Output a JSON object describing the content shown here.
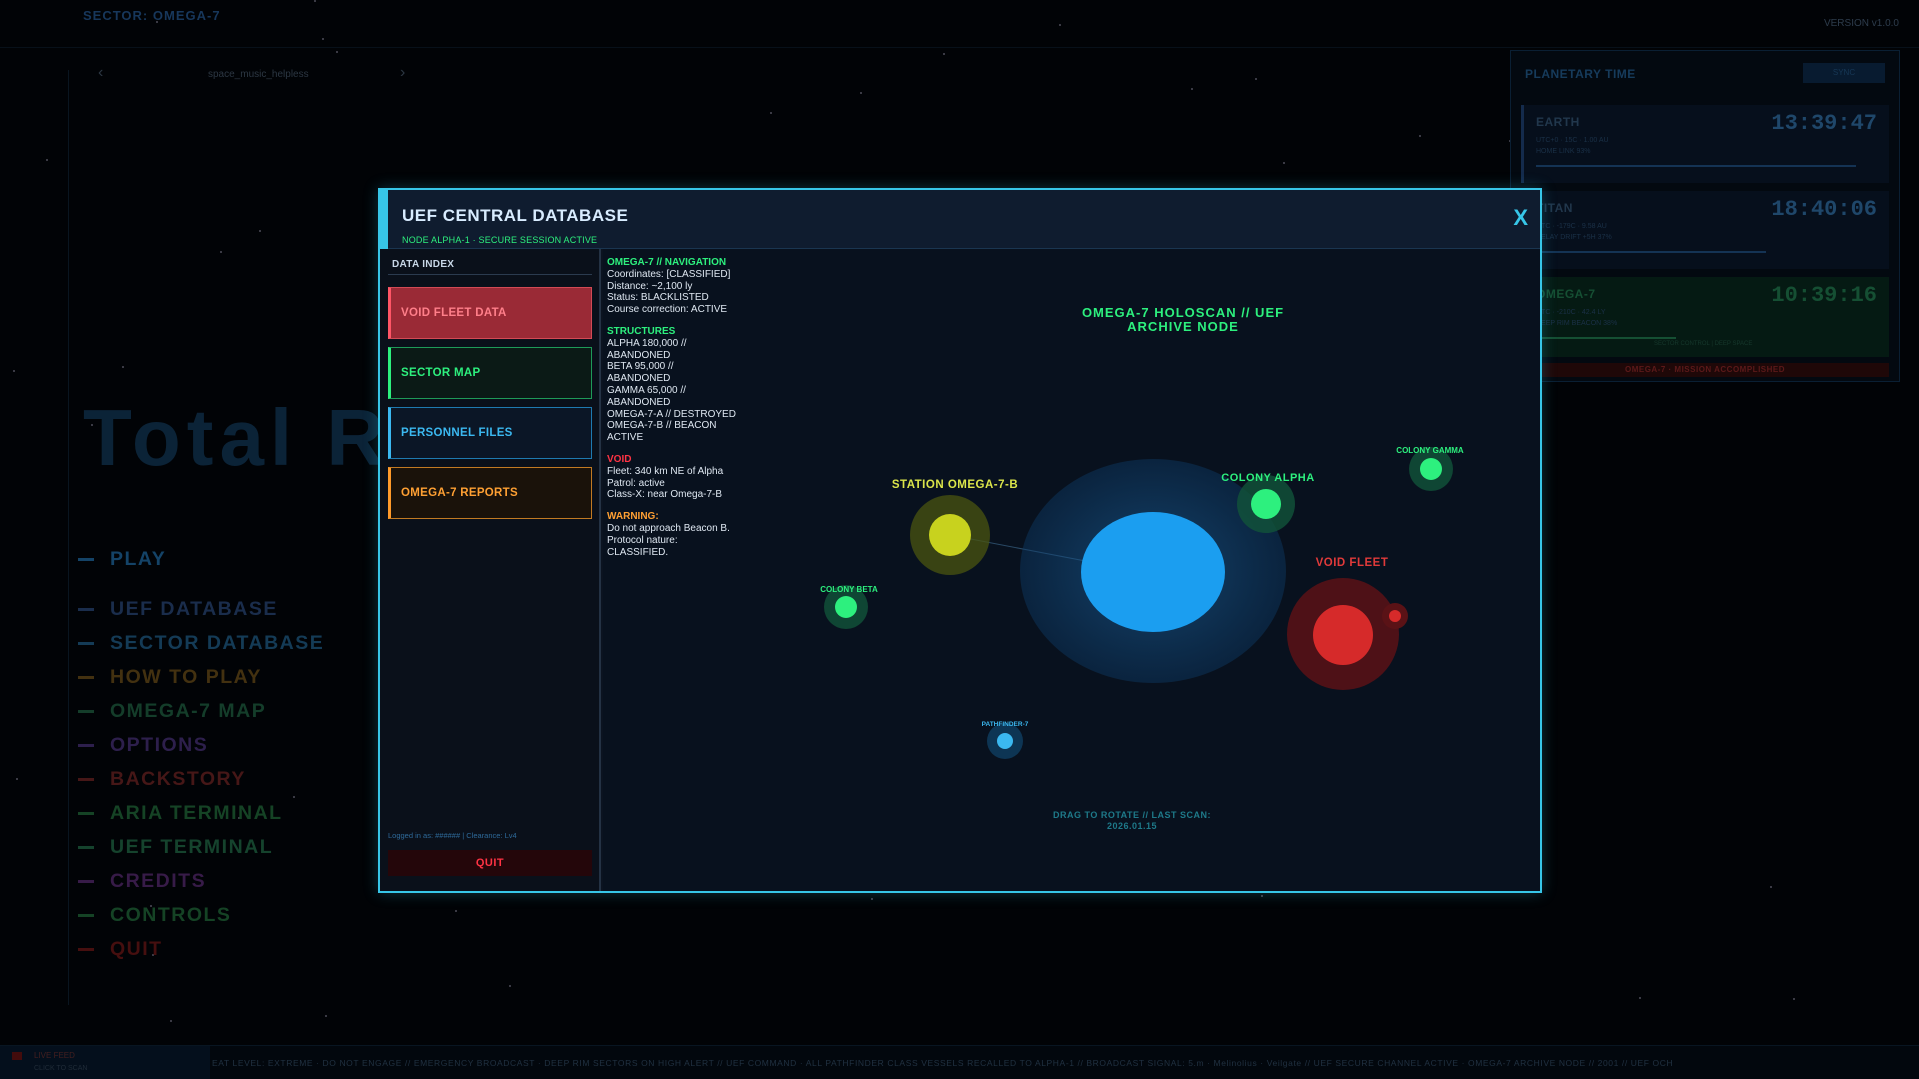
{
  "header": {
    "sector": "SECTOR: OMEGA-7",
    "version": "VERSION v1.0.0"
  },
  "music": {
    "prev_icon": "‹",
    "next_icon": "›",
    "track": "space_music_helpless"
  },
  "main_menu": {
    "title": "Total R",
    "items": [
      {
        "label": "PLAY",
        "color": "#1b5a8a"
      },
      {
        "label": "UEF DATABASE",
        "color": "#233d66"
      },
      {
        "label": "SECTOR DATABASE",
        "color": "#1b4f73"
      },
      {
        "label": "HOW TO PLAY",
        "color": "#5a4216"
      },
      {
        "label": "OMEGA-7 MAP",
        "color": "#1b5238"
      },
      {
        "label": "OPTIONS",
        "color": "#3d2a66"
      },
      {
        "label": "BACKSTORY",
        "color": "#5e1f1f"
      },
      {
        "label": "ARIA TERMINAL",
        "color": "#1c5a32"
      },
      {
        "label": "UEF TERMINAL",
        "color": "#1c5a3c"
      },
      {
        "label": "CREDITS",
        "color": "#4a2460"
      },
      {
        "label": "CONTROLS",
        "color": "#1c5a32"
      },
      {
        "label": "QUIT",
        "color": "#5e1414"
      }
    ]
  },
  "planetary_time": {
    "title": "PLANETARY TIME",
    "sync_label": "SYNC",
    "clocks": [
      {
        "name": "EARTH",
        "time": "13:39:47",
        "meta": "UTC+0  ·  15C  ·  1.00 AU",
        "meta2": "HOME LINK  93%"
      },
      {
        "name": "TITAN",
        "time": "18:40:06",
        "meta": "UTC  ·  -179C  ·  9.58 AU",
        "meta2": "RELAY DRIFT  +5H  37%"
      },
      {
        "name": "OMEGA-7",
        "time": "10:39:16",
        "meta": "UTC  ·  -210C  ·  42.4 LY",
        "meta2": "DEEP RIM BEACON  38%"
      }
    ],
    "omega_footer": "SECTOR CONTROL | DEEP SPACE",
    "mission_status": "OMEGA-7  ·  MISSION ACCOMPLISHED"
  },
  "live_feed": {
    "label": "LIVE FEED",
    "sub": "CLICK TO SCAN"
  },
  "ticker": "EAT LEVEL: EXTREME  ·  DO NOT ENGAGE  //  EMERGENCY BROADCAST  ·  DEEP RIM SECTORS ON HIGH ALERT  //  UEF COMMAND  ·  ALL PATHFINDER CLASS VESSELS RECALLED TO ALPHA-1  //  BROADCAST SIGNAL: 5.m · Melinolius · Veilgate  //  UEF SECURE CHANNEL ACTIVE · OMEGA-7 ARCHIVE NODE  //  2001 // UEF OCH",
  "modal": {
    "title": "UEF CENTRAL DATABASE",
    "subtitle": "NODE ALPHA-1  ·  SECURE SESSION ACTIVE",
    "close_label": "X",
    "sidebar_header": "DATA INDEX",
    "buttons": [
      {
        "label": "VOID FLEET DATA",
        "style": "red"
      },
      {
        "label": "SECTOR MAP",
        "style": "green"
      },
      {
        "label": "PERSONNEL FILES",
        "style": "blue"
      },
      {
        "label": "OMEGA-7 REPORTS",
        "style": "orange"
      }
    ],
    "login": "Logged in as: ######  |  Clearance: Lv4",
    "quit_label": "QUIT",
    "info": {
      "nav_header": "OMEGA-7 // NAVIGATION",
      "nav_lines": [
        "Coordinates: [CLASSIFIED]",
        "Distance: ~2,100 ly",
        "Status: BLACKLISTED",
        "Course correction: ACTIVE"
      ],
      "structures_header": "STRUCTURES",
      "structures_lines": [
        "ALPHA   180,000 // ABANDONED",
        "BETA     95,000 // ABANDONED",
        "GAMMA    65,000 // ABANDONED",
        "OMEGA-7-A // DESTROYED",
        "OMEGA-7-B // BEACON ACTIVE"
      ],
      "void_header": "VOID",
      "void_lines": [
        "Fleet: 340 km NE of Alpha",
        "Patrol: active",
        "Class-X: near Omega-7-B"
      ],
      "warning_header": "WARNING:",
      "warning_lines": [
        "Do not approach Beacon B.",
        "Protocol nature: CLASSIFIED."
      ]
    },
    "holoscan": {
      "title_line1": "OMEGA-7 HOLOSCAN  //  UEF",
      "title_line2": "ARCHIVE NODE",
      "footer_line1": "DRAG TO ROTATE  //  LAST SCAN:",
      "footer_line2": "2026.01.15",
      "labels": {
        "station": "STATION OMEGA-7-B",
        "colony_alpha": "COLONY ALPHA",
        "colony_gamma": "COLONY GAMMA",
        "colony_beta": "COLONY BETA",
        "void_fleet": "VOID FLEET",
        "pathfinder": "PATHFINDER-7"
      },
      "colors": {
        "planet": "#1b9ef0",
        "colony": "#2df07e",
        "station": "#c8d21e",
        "void": "#d62a2a",
        "pathfinder": "#3bb8f0"
      }
    }
  }
}
